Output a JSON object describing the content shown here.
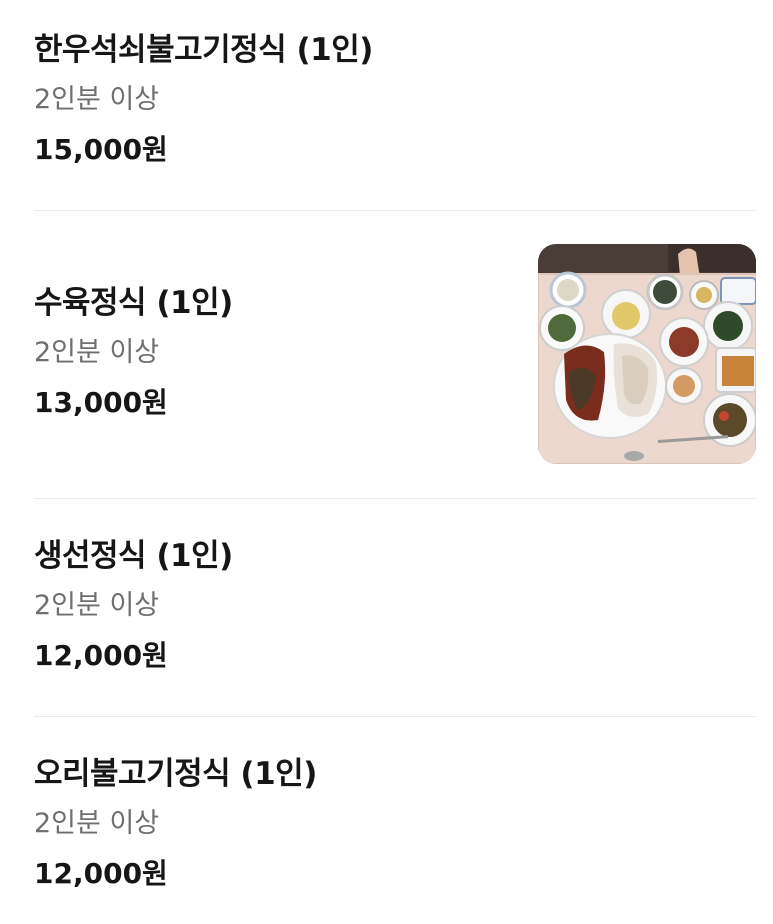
{
  "menu_items": [
    {
      "name": "한우석쇠불고기정식 (1인)",
      "note": "2인분 이상",
      "price": "15,000원"
    },
    {
      "name": "수육정식 (1인)",
      "note": "2인분 이상",
      "price": "13,000원",
      "has_photo": true
    },
    {
      "name": "생선정식 (1인)",
      "note": "2인분 이상",
      "price": "12,000원"
    },
    {
      "name": "오리불고기정식 (1인)",
      "note": "2인분 이상",
      "price": "12,000원"
    }
  ]
}
